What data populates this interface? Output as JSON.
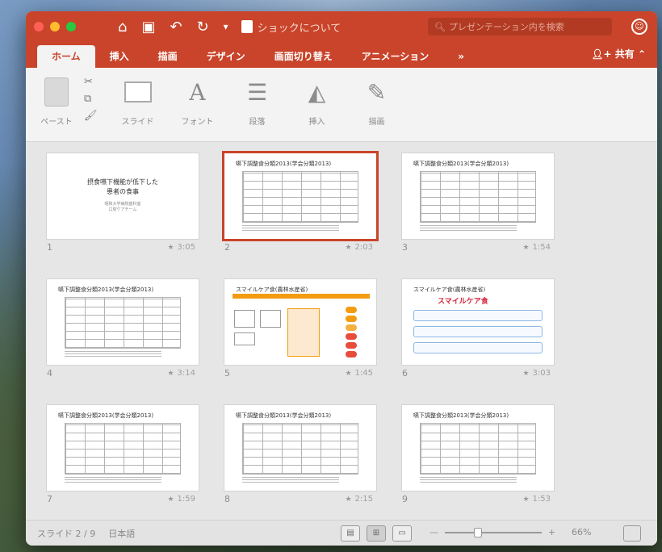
{
  "titlebar": {
    "doc_title": "ショックについて",
    "search_placeholder": "プレゼンテーション内を検索",
    "qa_icons": [
      "home-icon",
      "save-icon",
      "undo-icon",
      "redo-icon",
      "customize-icon"
    ]
  },
  "tabs": [
    "ホーム",
    "挿入",
    "描画",
    "デザイン",
    "画面切り替え",
    "アニメーション",
    "»"
  ],
  "active_tab": "ホーム",
  "share_label": "共有",
  "ribbon": {
    "paste_label": "ペースト",
    "slide_label": "スライド",
    "font_label": "フォント",
    "paragraph_label": "段落",
    "insert_label": "挿入",
    "draw_label": "描画"
  },
  "slides": [
    {
      "num": "1",
      "time": "3:05",
      "title": "摂食嚥下機能が低下した\n患者の食事",
      "type": "title",
      "sub": "昭和大学病院歯科室\n口腔ケアチーム"
    },
    {
      "num": "2",
      "time": "2:03",
      "title": "嚥下調整食分類2013(学会分類2013)",
      "type": "table",
      "selected": true
    },
    {
      "num": "3",
      "time": "1:54",
      "title": "嚥下調整食分類2013(学会分類2013)",
      "type": "table"
    },
    {
      "num": "4",
      "time": "3:14",
      "title": "嚥下調整食分類2013(学会分類2013)",
      "type": "table"
    },
    {
      "num": "5",
      "time": "1:45",
      "title": "スマイルケア食(農林水産省)",
      "type": "flow"
    },
    {
      "num": "6",
      "time": "3:03",
      "title": "スマイルケア食(農林水産省)",
      "type": "smile",
      "logo": "スマイルケア食"
    },
    {
      "num": "7",
      "time": "1:59",
      "title": "嚥下調整食分類2013(学会分類2013)",
      "type": "table"
    },
    {
      "num": "8",
      "time": "2:15",
      "title": "嚥下調整食分類2013(学会分類2013)",
      "type": "table"
    },
    {
      "num": "9",
      "time": "1:53",
      "title": "嚥下調整食分類2013(学会分類2013)",
      "type": "table"
    }
  ],
  "status": {
    "slide_info": "スライド 2 / 9",
    "language": "日本語",
    "zoom": "66%"
  },
  "colors": {
    "accent": "#c9442a",
    "selection": "#c9442a"
  }
}
